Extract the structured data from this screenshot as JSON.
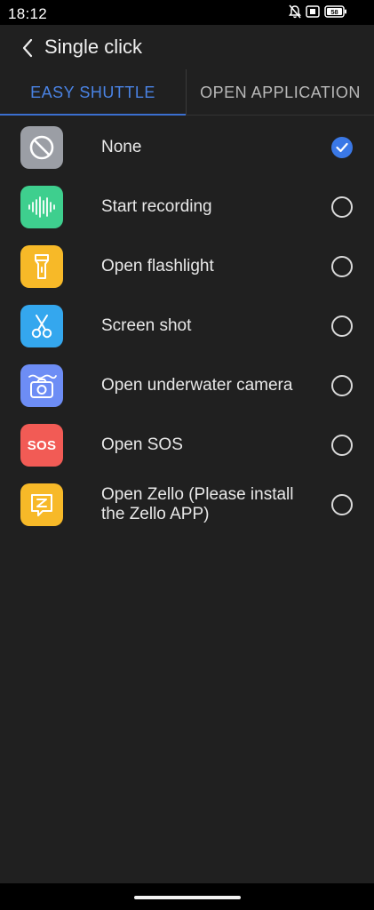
{
  "status_bar": {
    "time": "18:12",
    "icons": [
      "bell-off-icon",
      "sim-card-icon",
      "battery-icon"
    ],
    "battery_level": "58"
  },
  "header": {
    "back_icon": "chevron-left-icon",
    "title": "Single click"
  },
  "tabs": [
    {
      "label": "EASY SHUTTLE",
      "active": true
    },
    {
      "label": "OPEN APPLICATION",
      "active": false
    }
  ],
  "options": [
    {
      "label": "None",
      "icon": "no-entry-icon",
      "color": "#9b9ea5",
      "selected": true
    },
    {
      "label": "Start recording",
      "icon": "sound-wave-icon",
      "color": "#3ecf8e",
      "selected": false
    },
    {
      "label": "Open flashlight",
      "icon": "flashlight-icon",
      "color": "#f7b928",
      "selected": false
    },
    {
      "label": "Screen shot",
      "icon": "scissors-icon",
      "color": "#34a7ee",
      "selected": false
    },
    {
      "label": "Open underwater camera",
      "icon": "underwater-camera-icon",
      "color": "#6d8df5",
      "selected": false
    },
    {
      "label": "Open SOS",
      "icon": "sos-icon",
      "color": "#f25b55",
      "icon_text": "SOS",
      "selected": false
    },
    {
      "label": "Open Zello (Please install the Zello APP)",
      "icon": "zello-icon",
      "color": "#f7b928",
      "selected": false
    }
  ],
  "colors": {
    "accent": "#3a78e6",
    "background": "#202020"
  }
}
